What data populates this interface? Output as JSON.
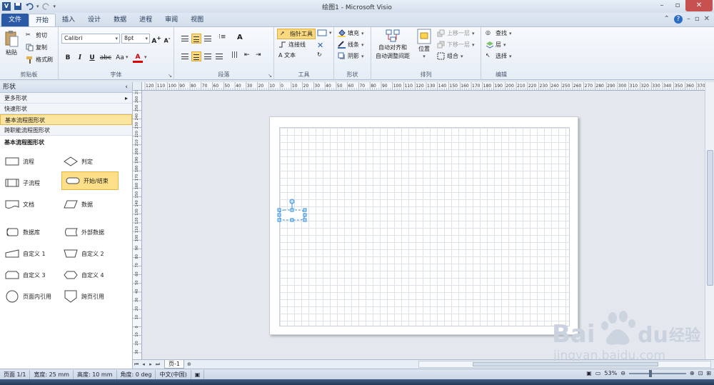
{
  "window": {
    "title": "绘图1 - Microsoft Visio"
  },
  "tabs": [
    "文件",
    "开始",
    "插入",
    "设计",
    "数据",
    "进程",
    "审阅",
    "视图"
  ],
  "ribbon": {
    "clipboard": {
      "paste": "粘贴",
      "cut": "剪切",
      "copy": "复制",
      "format_painter": "格式刷",
      "label": "剪贴板"
    },
    "font": {
      "name": "Calibri",
      "size": "8pt",
      "bold": "B",
      "italic": "I",
      "underline": "U",
      "strike": "abc",
      "case": "Aa",
      "color": "A",
      "grow": "A",
      "label": "字体"
    },
    "paragraph": {
      "label": "段落"
    },
    "tools": {
      "pointer": "指针工具",
      "connector": "连接线",
      "text": "A 文本",
      "label": "工具"
    },
    "shape": {
      "fill": "填充",
      "line": "线条",
      "shadow": "阴影",
      "label": "形状"
    },
    "arrange": {
      "auto_align": "自动对齐和",
      "auto_space": "自动调整间距",
      "position": "位置",
      "bring_forward": "上移一层",
      "send_backward": "下移一层",
      "group": "组合",
      "label": "排列"
    },
    "editing": {
      "find": "查找",
      "layers": "层",
      "select": "选择",
      "label": "编辑"
    }
  },
  "shapes_pane": {
    "header": "形状",
    "rows": [
      "更多形状",
      "快速形状",
      "基本流程图形状",
      "跨职能流程图形状"
    ],
    "stencil_title": "基本流程图形状",
    "shapes": [
      {
        "label": "流程",
        "icon": "process-shape-icon"
      },
      {
        "label": "判定",
        "icon": "decision-shape-icon"
      },
      {
        "label": "子流程",
        "icon": "subprocess-shape-icon"
      },
      {
        "label": "开始/结束",
        "icon": "terminator-shape-icon"
      },
      {
        "label": "文档",
        "icon": "document-shape-icon"
      },
      {
        "label": "数据",
        "icon": "data-shape-icon"
      },
      {
        "label": "数据库",
        "icon": "database-shape-icon"
      },
      {
        "label": "外部数据",
        "icon": "external-data-shape-icon"
      },
      {
        "label": "自定义 1",
        "icon": "custom1-shape-icon"
      },
      {
        "label": "自定义 2",
        "icon": "custom2-shape-icon"
      },
      {
        "label": "自定义 3",
        "icon": "custom3-shape-icon"
      },
      {
        "label": "自定义 4",
        "icon": "custom4-shape-icon"
      },
      {
        "label": "页面内引用",
        "icon": "on-page-ref-shape-icon"
      },
      {
        "label": "跨页引用",
        "icon": "off-page-ref-shape-icon"
      }
    ]
  },
  "ruler": {
    "h_ticks": [
      "120",
      "110",
      "100",
      "90",
      "80",
      "70",
      "60",
      "50",
      "40",
      "30",
      "20",
      "10",
      "0",
      "10",
      "20",
      "30",
      "40",
      "50",
      "60",
      "70",
      "80",
      "90",
      "100",
      "110",
      "120",
      "130",
      "140",
      "150",
      "160",
      "170",
      "180",
      "190",
      "200",
      "210",
      "220",
      "230",
      "240",
      "250",
      "260",
      "270",
      "280",
      "290",
      "300",
      "310",
      "320",
      "330",
      "340",
      "350",
      "360",
      "370"
    ],
    "v_ticks": [
      "270",
      "260",
      "250",
      "240",
      "230",
      "220",
      "210",
      "200",
      "190",
      "180",
      "170",
      "160",
      "150",
      "140",
      "130",
      "120",
      "110",
      "100",
      "90",
      "80",
      "70",
      "60",
      "50",
      "40",
      "30",
      "20",
      "10",
      "0",
      "10",
      "20",
      "30"
    ]
  },
  "page_tabs": {
    "current": "页-1"
  },
  "status": {
    "page": "页面 1/1",
    "width": "宽度: 25 mm",
    "height": "高度: 10 mm",
    "angle": "角度: 0 deg",
    "language": "中文(中国)",
    "zoom": "53%"
  },
  "watermark": {
    "brand": "Bai",
    "brand2": "du",
    "cn": "经验",
    "url": "jingyan.baidu.com"
  },
  "colors": {
    "accent": "#2a5aa5",
    "highlight": "#fcdf88",
    "selection": "#3a8fd6"
  }
}
